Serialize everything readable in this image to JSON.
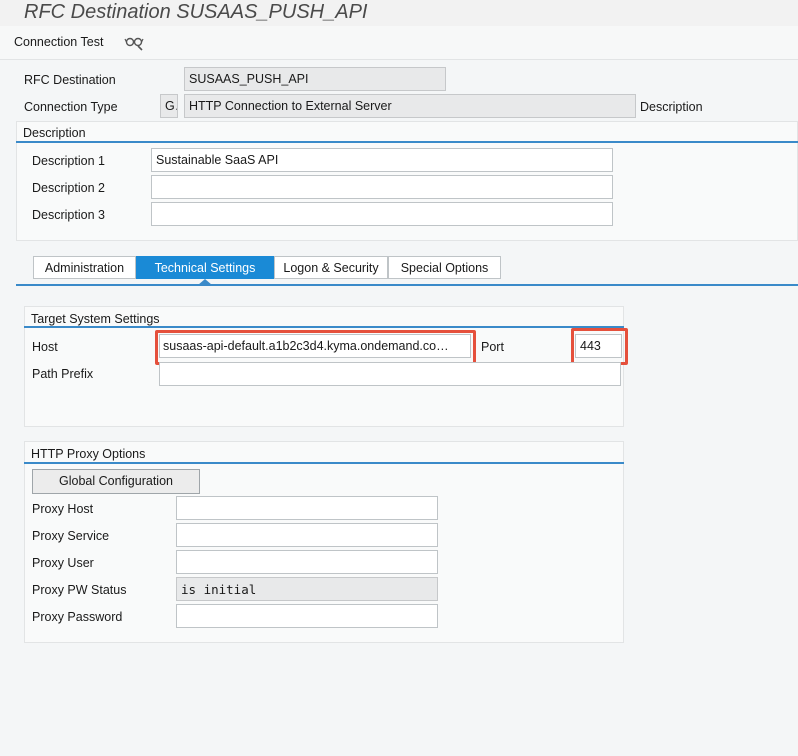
{
  "window": {
    "title": "RFC Destination SUSAAS_PUSH_API"
  },
  "toolbar": {
    "connection_test_label": "Connection Test",
    "test_icon": "glasses-test-icon"
  },
  "header": {
    "rfc_destination_label": "RFC Destination",
    "rfc_destination_value": "SUSAAS_PUSH_API",
    "connection_type_label": "Connection Type",
    "connection_type_code": "G",
    "connection_type_value": "HTTP Connection to External Server",
    "connection_type_suffix": "Description"
  },
  "description": {
    "title": "Description",
    "fields": [
      {
        "label": "Description 1",
        "value": "Sustainable SaaS API"
      },
      {
        "label": "Description 2",
        "value": ""
      },
      {
        "label": "Description 3",
        "value": ""
      }
    ]
  },
  "tabs": [
    {
      "label": "Administration",
      "active": false
    },
    {
      "label": "Technical Settings",
      "active": true
    },
    {
      "label": "Logon & Security",
      "active": false
    },
    {
      "label": "Special Options",
      "active": false
    }
  ],
  "target_system": {
    "title": "Target System Settings",
    "host_label": "Host",
    "host_value": "susaas-api-default.a1b2c3d4.kyma.ondemand.co…",
    "port_label": "Port",
    "port_value": "443",
    "path_prefix_label": "Path Prefix",
    "path_prefix_value": ""
  },
  "proxy": {
    "title": "HTTP Proxy Options",
    "global_config_label": "Global Configuration",
    "fields": [
      {
        "label": "Proxy Host",
        "value": ""
      },
      {
        "label": "Proxy Service",
        "value": ""
      },
      {
        "label": "Proxy User",
        "value": ""
      },
      {
        "label": "Proxy PW Status",
        "value": "is initial"
      },
      {
        "label": "Proxy Password",
        "value": ""
      }
    ]
  },
  "colors": {
    "accent": "#1a8ad6",
    "highlight": "#e5503c",
    "background": "#f4f6f7"
  }
}
